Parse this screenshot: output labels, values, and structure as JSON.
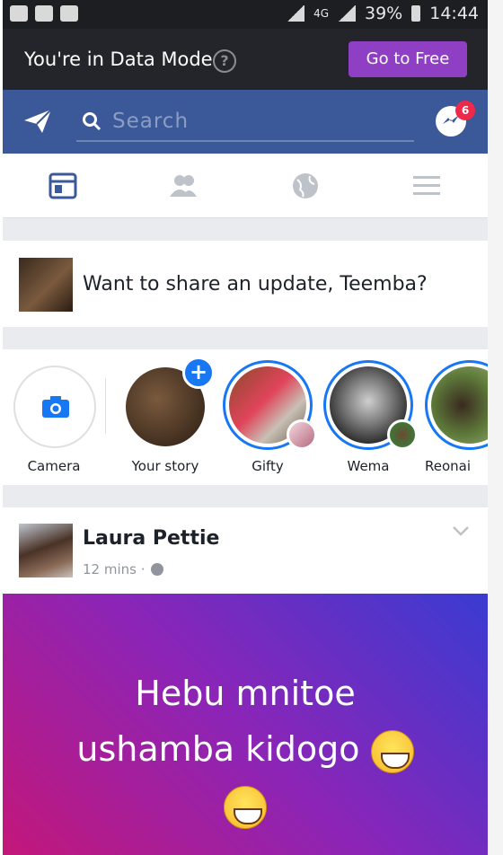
{
  "status_bar": {
    "network": "4G",
    "battery": "39%",
    "time": "14:44"
  },
  "data_mode": {
    "message": "You're in Data Mode",
    "help_icon": "?",
    "button": "Go to Free",
    "button_color": "#8f3fc3"
  },
  "header": {
    "search_placeholder": "Search",
    "messenger_badge": "6",
    "brand_color": "#3b5998"
  },
  "tabs": [
    "news-feed-icon",
    "friends-icon",
    "notifications-globe-icon",
    "menu-icon"
  ],
  "composer": {
    "prompt": "Want to share an update, Teemba?"
  },
  "stories": {
    "camera_label": "Camera",
    "your_story_label": "Your story",
    "items": [
      {
        "label": "Gifty"
      },
      {
        "label": "Wema"
      },
      {
        "label": "Reonai"
      }
    ]
  },
  "post": {
    "author": "Laura Pettie",
    "time": "12 mins",
    "line1": "Hebu mnitoe",
    "line2": "ushamba kidogo"
  }
}
